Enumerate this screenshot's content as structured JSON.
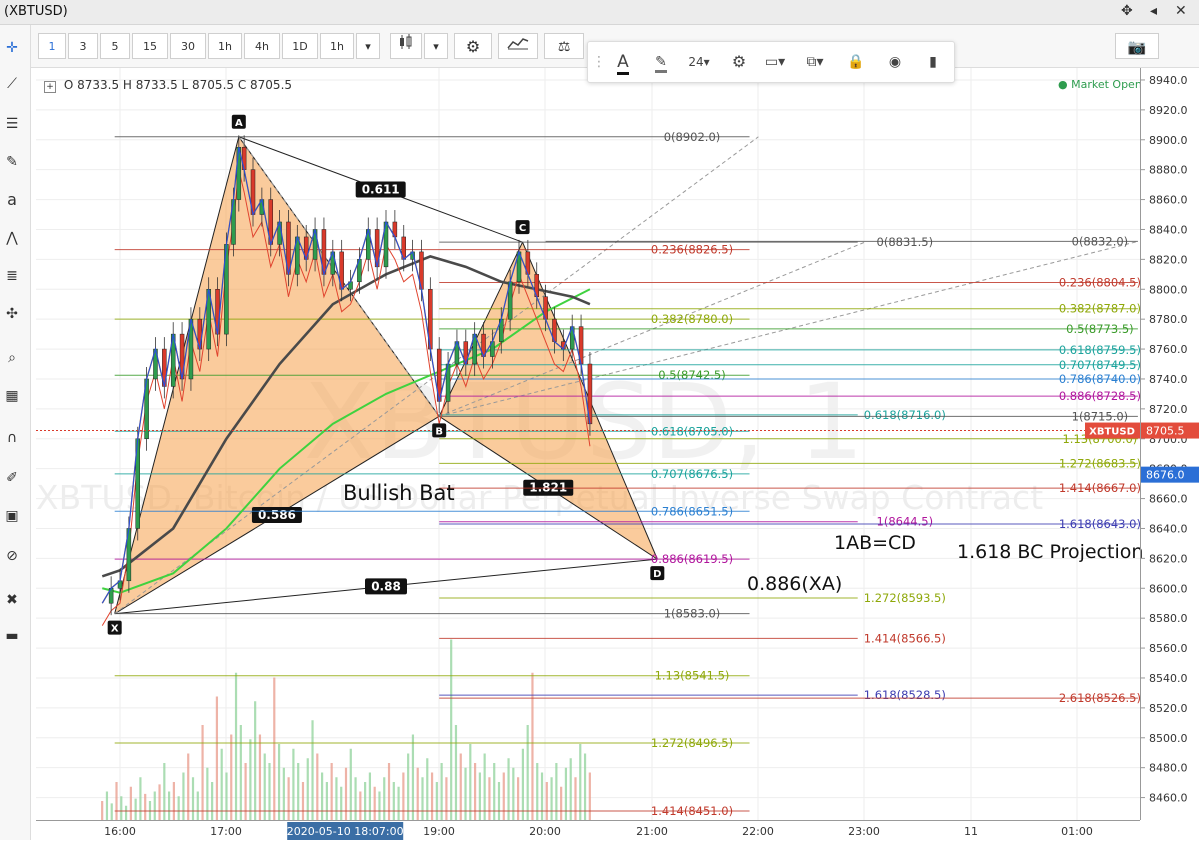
{
  "window": {
    "title": "(XBTUSD)",
    "controls": [
      "✥",
      "◂",
      "✕"
    ]
  },
  "toolbar": {
    "intervals": [
      "1",
      "3",
      "5",
      "15",
      "30",
      "1h",
      "4h",
      "1D",
      "1h"
    ],
    "active_interval": "1"
  },
  "drawing_toolbar": {
    "font_size": "24"
  },
  "legend": {
    "ohlc": "O 8733.5 H 8733.5 L 8705.5 C 8705.5",
    "market_status": "Market Open"
  },
  "watermark": {
    "main": "XBTUSD, 1",
    "sub": "XBTUSD, Bitcoin / US Dollar Perpetual Inverse Swap Contract"
  },
  "annotations": {
    "pattern_name": "Bullish Bat",
    "abcd": "1AB=CD",
    "bc_projection": "1.618 BC Projection",
    "xa_level": "0.886(XA)"
  },
  "chart_data": {
    "type": "line",
    "symbol": "XBTUSD",
    "ylim": [
      8445,
      8948
    ],
    "y_ticks": [
      8460,
      8480,
      8500,
      8520,
      8540,
      8560,
      8580,
      8600,
      8620,
      8640,
      8660,
      8680,
      8700,
      8720,
      8740,
      8760,
      8780,
      8800,
      8820,
      8840,
      8860,
      8880,
      8900,
      8920,
      8940
    ],
    "x_ticks": [
      "16:00",
      "17:00",
      "19:00",
      "20:00",
      "21:00",
      "22:00",
      "23:00",
      "11",
      "01:00"
    ],
    "time_cursor_label": "2020-05-10 18:07:00",
    "last_price": {
      "label": "XBTUSD",
      "value": "8705.5"
    },
    "price_label_2": "8676.0",
    "points": [
      {
        "label": "X",
        "t": "15:57",
        "price": 8583.0
      },
      {
        "label": "A",
        "t": "17:07",
        "price": 8902.0
      },
      {
        "label": "B",
        "t": "19:00",
        "price": 8715.0
      },
      {
        "label": "C",
        "t": "19:47",
        "price": 8831.5
      },
      {
        "label": "D",
        "t": "21:03",
        "price": 8619.5
      }
    ],
    "pattern_ratios": [
      {
        "label": "0.586",
        "on": "XB"
      },
      {
        "label": "0.611",
        "on": "AC"
      },
      {
        "label": "1.821",
        "on": "BD"
      },
      {
        "label": "0.88",
        "on": "XD"
      }
    ],
    "fib_levels": [
      {
        "text": "0(8902.0)",
        "price": 8902.0,
        "t0": "15:57",
        "t1": "21:55",
        "color": "#555555",
        "label_t": "21:00"
      },
      {
        "text": "0.236(8826.5)",
        "price": 8826.5,
        "t0": "15:57",
        "t1": "21:55",
        "color": "#c0392b",
        "label_t": "21:00"
      },
      {
        "text": "0.382(8780.0)",
        "price": 8780.0,
        "t0": "15:57",
        "t1": "21:55",
        "color": "#8fa80a",
        "label_t": "21:00"
      },
      {
        "text": "0.5(8742.5)",
        "price": 8742.5,
        "t0": "15:57",
        "t1": "21:55",
        "color": "#3a9b2a",
        "label_t": "21:00"
      },
      {
        "text": "0.618(8705.0)",
        "price": 8705.0,
        "t0": "15:57",
        "t1": "21:55",
        "color": "#1ba39c",
        "label_t": "21:00"
      },
      {
        "text": "0.707(8676.5)",
        "price": 8676.5,
        "t0": "15:57",
        "t1": "21:55",
        "color": "#1ba39c",
        "label_t": "21:00"
      },
      {
        "text": "0.786(8651.5)",
        "price": 8651.5,
        "t0": "15:57",
        "t1": "21:55",
        "color": "#2a7fd1",
        "label_t": "21:00"
      },
      {
        "text": "0.886(8619.5)",
        "price": 8619.5,
        "t0": "15:57",
        "t1": "21:55",
        "color": "#b0149c",
        "label_t": "21:00"
      },
      {
        "text": "1(8583.0)",
        "price": 8583.0,
        "t0": "15:57",
        "t1": "21:55",
        "color": "#555555",
        "label_t": "21:00"
      },
      {
        "text": "1.13(8541.5)",
        "price": 8541.5,
        "t0": "15:57",
        "t1": "21:55",
        "color": "#8fa80a",
        "label_t": "21:00"
      },
      {
        "text": "1.272(8496.5)",
        "price": 8496.5,
        "t0": "15:57",
        "t1": "21:55",
        "color": "#8fa80a",
        "label_t": "21:00"
      },
      {
        "text": "1.414(8451.0)",
        "price": 8451.0,
        "t0": "15:57",
        "t1": "21:55",
        "color": "#c0392b",
        "label_t": "21:00"
      },
      {
        "text": "0(8831.5)",
        "price": 8831.5,
        "t0": "19:00",
        "t1": "22:56",
        "color": "#555555",
        "label_t": "23:00"
      },
      {
        "text": "0.618(8716.0)",
        "price": 8716.0,
        "t0": "19:00",
        "t1": "22:56",
        "color": "#1ba39c",
        "label_t": "23:00"
      },
      {
        "text": "1(8644.5)",
        "price": 8644.5,
        "t0": "19:00",
        "t1": "22:56",
        "color": "#b0149c",
        "label_t": "23:00"
      },
      {
        "text": "1.272(8593.5)",
        "price": 8593.5,
        "t0": "19:00",
        "t1": "22:56",
        "color": "#8fa80a",
        "label_t": "23:00"
      },
      {
        "text": "1.414(8566.5)",
        "price": 8566.5,
        "t0": "19:00",
        "t1": "22:56",
        "color": "#c0392b",
        "label_t": "23:00"
      },
      {
        "text": "1.618(8528.5)",
        "price": 8528.5,
        "t0": "19:00",
        "t1": "22:56",
        "color": "#3b3bb0",
        "label_t": "23:00"
      },
      {
        "text": "0(8832.0)",
        "price": 8832.0,
        "t0": "20:00",
        "t1": "01:34",
        "color": "#555555",
        "label_t": "01:34"
      },
      {
        "text": "0.236(8804.5)",
        "price": 8804.5,
        "t0": "19:00",
        "t1": "01:34",
        "color": "#c0392b",
        "label_t": "01:34"
      },
      {
        "text": "0.382(8787.0)",
        "price": 8787.0,
        "t0": "19:00",
        "t1": "01:34",
        "color": "#8fa80a",
        "label_t": "01:34"
      },
      {
        "text": "0.5(8773.5)",
        "price": 8773.5,
        "t0": "19:00",
        "t1": "01:34",
        "color": "#3a9b2a",
        "label_t": "01:34"
      },
      {
        "text": "0.618(8759.5)",
        "price": 8759.5,
        "t0": "19:00",
        "t1": "01:34",
        "color": "#1ba39c",
        "label_t": "01:34"
      },
      {
        "text": "0.707(8749.5)",
        "price": 8749.5,
        "t0": "19:00",
        "t1": "01:34",
        "color": "#1ba39c",
        "label_t": "01:34"
      },
      {
        "text": "0.786(8740.0)",
        "price": 8740.0,
        "t0": "19:00",
        "t1": "01:34",
        "color": "#2a7fd1",
        "label_t": "01:34"
      },
      {
        "text": "0.886(8728.5)",
        "price": 8728.5,
        "t0": "19:00",
        "t1": "01:34",
        "color": "#b0149c",
        "label_t": "01:34"
      },
      {
        "text": "1(8715.0)",
        "price": 8715.0,
        "t0": "19:00",
        "t1": "01:34",
        "color": "#555555",
        "label_t": "01:34"
      },
      {
        "text": "1.13(8700.0)",
        "price": 8700.0,
        "t0": "19:00",
        "t1": "01:34",
        "color": "#8fa80a",
        "label_t": "01:34"
      },
      {
        "text": "1.272(8683.5)",
        "price": 8683.5,
        "t0": "19:00",
        "t1": "01:34",
        "color": "#8fa80a",
        "label_t": "01:34"
      },
      {
        "text": "1.414(8667.0)",
        "price": 8667.0,
        "t0": "19:00",
        "t1": "01:34",
        "color": "#c0392b",
        "label_t": "01:34"
      },
      {
        "text": "1.618(8643.0)",
        "price": 8643.0,
        "t0": "19:00",
        "t1": "01:34",
        "color": "#3b3bb0",
        "label_t": "01:34"
      },
      {
        "text": "2.618(8526.5)",
        "price": 8526.5,
        "t0": "19:00",
        "t1": "01:34",
        "color": "#c0392b",
        "label_t": "01:34"
      }
    ],
    "price_path": [
      [
        "15:50",
        8590
      ],
      [
        "15:55",
        8600
      ],
      [
        "16:00",
        8605
      ],
      [
        "16:05",
        8640
      ],
      [
        "16:10",
        8700
      ],
      [
        "16:15",
        8740
      ],
      [
        "16:20",
        8760
      ],
      [
        "16:25",
        8735
      ],
      [
        "16:30",
        8770
      ],
      [
        "16:35",
        8740
      ],
      [
        "16:40",
        8780
      ],
      [
        "16:45",
        8760
      ],
      [
        "16:50",
        8800
      ],
      [
        "16:55",
        8770
      ],
      [
        "17:00",
        8830
      ],
      [
        "17:04",
        8860
      ],
      [
        "17:07",
        8895
      ],
      [
        "17:10",
        8880
      ],
      [
        "17:15",
        8850
      ],
      [
        "17:20",
        8860
      ],
      [
        "17:25",
        8830
      ],
      [
        "17:30",
        8845
      ],
      [
        "17:35",
        8810
      ],
      [
        "17:40",
        8835
      ],
      [
        "17:45",
        8820
      ],
      [
        "17:50",
        8840
      ],
      [
        "17:55",
        8810
      ],
      [
        "18:00",
        8825
      ],
      [
        "18:05",
        8800
      ],
      [
        "18:10",
        8805
      ],
      [
        "18:15",
        8820
      ],
      [
        "18:20",
        8840
      ],
      [
        "18:25",
        8815
      ],
      [
        "18:30",
        8845
      ],
      [
        "18:35",
        8835
      ],
      [
        "18:40",
        8820
      ],
      [
        "18:45",
        8825
      ],
      [
        "18:50",
        8800
      ],
      [
        "18:55",
        8760
      ],
      [
        "19:00",
        8725
      ],
      [
        "19:05",
        8750
      ],
      [
        "19:10",
        8765
      ],
      [
        "19:15",
        8750
      ],
      [
        "19:20",
        8770
      ],
      [
        "19:25",
        8755
      ],
      [
        "19:30",
        8765
      ],
      [
        "19:35",
        8780
      ],
      [
        "19:40",
        8805
      ],
      [
        "19:45",
        8825
      ],
      [
        "19:50",
        8810
      ],
      [
        "19:55",
        8795
      ],
      [
        "20:00",
        8780
      ],
      [
        "20:05",
        8765
      ],
      [
        "20:10",
        8760
      ],
      [
        "20:15",
        8775
      ],
      [
        "20:20",
        8750
      ],
      [
        "20:25",
        8710
      ]
    ],
    "ma_slow": [
      [
        "15:50",
        8608
      ],
      [
        "16:00",
        8612
      ],
      [
        "16:30",
        8640
      ],
      [
        "17:00",
        8700
      ],
      [
        "17:30",
        8750
      ],
      [
        "18:00",
        8790
      ],
      [
        "18:30",
        8810
      ],
      [
        "18:55",
        8822
      ],
      [
        "19:15",
        8815
      ],
      [
        "19:35",
        8805
      ],
      [
        "19:55",
        8800
      ],
      [
        "20:15",
        8795
      ],
      [
        "20:25",
        8790
      ]
    ],
    "ma_green": [
      [
        "15:50",
        8600
      ],
      [
        "16:00",
        8597
      ],
      [
        "16:30",
        8610
      ],
      [
        "17:00",
        8640
      ],
      [
        "17:30",
        8680
      ],
      [
        "18:00",
        8710
      ],
      [
        "18:30",
        8730
      ],
      [
        "19:00",
        8745
      ],
      [
        "19:30",
        8760
      ],
      [
        "20:00",
        8785
      ],
      [
        "20:25",
        8800
      ]
    ],
    "volume": {
      "approx_max": 400,
      "bars": [
        40,
        60,
        35,
        80,
        50,
        30,
        70,
        45,
        90,
        55,
        40,
        60,
        75,
        120,
        60,
        80,
        50,
        100,
        140,
        90,
        60,
        200,
        110,
        80,
        260,
        150,
        100,
        180,
        310,
        200,
        120,
        170,
        250,
        180,
        140,
        120,
        300,
        160,
        110,
        90,
        150,
        120,
        80,
        130,
        210,
        140,
        100,
        80,
        120,
        90,
        70,
        110,
        150,
        90,
        60,
        80,
        100,
        70,
        60,
        90,
        120,
        80,
        70,
        100,
        140,
        180,
        110,
        90,
        130,
        100,
        80,
        120,
        90,
        380,
        200,
        140,
        110,
        160,
        120,
        100,
        140,
        90,
        120,
        80,
        100,
        130,
        110,
        90,
        150,
        200,
        310,
        120,
        100,
        80,
        90,
        120,
        70,
        110,
        130,
        90,
        160,
        140,
        100
      ]
    }
  }
}
